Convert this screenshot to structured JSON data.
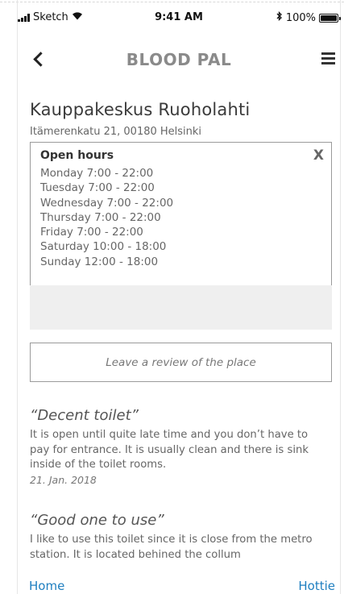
{
  "status_bar": {
    "carrier": "Sketch",
    "time": "9:41 AM",
    "battery_text": "100%",
    "battery_level": 1.0,
    "icons": [
      "signal-icon",
      "wifi-icon",
      "bluetooth-icon",
      "battery-icon"
    ]
  },
  "header": {
    "title": "BLOOD PAL",
    "back_icon": "chevron-left-icon",
    "menu_icon": "hamburger-menu-icon"
  },
  "place": {
    "name": "Kauppakeskus Ruoholahti",
    "address": "Itämerenkatu 21, 00180 Helsinki"
  },
  "open_hours": {
    "title": "Open hours",
    "close_label": "X",
    "days": [
      "Monday 7:00 - 22:00",
      "Tuesday 7:00 - 22:00",
      "Wednesday 7:00 - 22:00",
      "Thursday 7:00 - 22:00",
      "Friday 7:00 - 22:00",
      "Saturday 10:00 - 18:00",
      "Sunday 12:00 - 18:00"
    ]
  },
  "review_button": {
    "label": "Leave a review of the place"
  },
  "reviews": [
    {
      "title": "“Decent toilet”",
      "body": "It is open until quite late time and you don’t have to pay for entrance. It is usually clean and there is sink inside of the toilet rooms.",
      "date": "21. Jan. 2018"
    },
    {
      "title": "“Good one to use”",
      "body": "I like to use this toilet since it is close from the metro station. It is located behined the collum",
      "date": ""
    }
  ],
  "tab_bar": {
    "home": "Home",
    "hottie": "Hottie"
  },
  "colors": {
    "link": "#1f7fc0",
    "title_grey": "#8a8a8a",
    "border": "#9b9b9b",
    "placeholder_bg": "#efefef"
  }
}
